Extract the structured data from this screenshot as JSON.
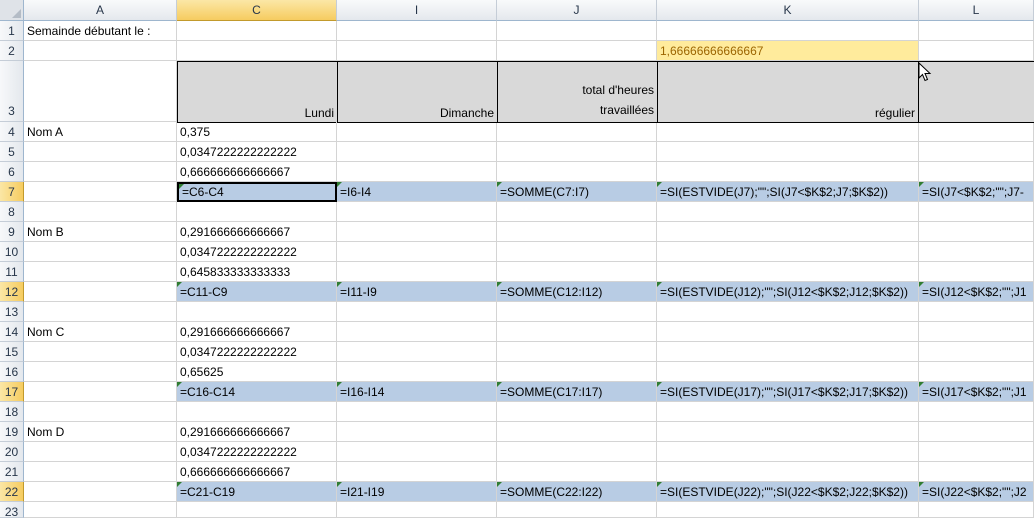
{
  "columns": [
    "A",
    "C",
    "I",
    "J",
    "K",
    "L"
  ],
  "rows": [
    "1",
    "2",
    "3",
    "4",
    "5",
    "6",
    "7",
    "8",
    "9",
    "10",
    "11",
    "12",
    "13",
    "14",
    "15",
    "16",
    "17",
    "18",
    "19",
    "20",
    "21",
    "22",
    "23"
  ],
  "cells": {
    "a1": "Semainde débutant le :",
    "k2": "1,66666666666667",
    "c3": "Lundi",
    "i3": "Dimanche",
    "j3_line1": "total d'heures",
    "j3_line2": "travaillées",
    "k3": "régulier",
    "a4": "Nom A",
    "c4": "0,375",
    "c5": "0,0347222222222222",
    "c6": "0,666666666666667",
    "c7": "=C6-C4",
    "i7": "=I6-I4",
    "j7": "=SOMME(C7:I7)",
    "k7": "=SI(ESTVIDE(J7);\"\";SI(J7<$K$2;J7;$K$2))",
    "l7": "=SI(J7<$K$2;\"\";J7-",
    "a9": "Nom B",
    "c9": "0,291666666666667",
    "c10": "0,0347222222222222",
    "c11": "0,645833333333333",
    "c12": "=C11-C9",
    "i12": "=I11-I9",
    "j12": "=SOMME(C12:I12)",
    "k12": "=SI(ESTVIDE(J12);\"\";SI(J12<$K$2;J12;$K$2))",
    "l12": "=SI(J12<$K$2;\"\";J1",
    "a14": "Nom C",
    "c14": "0,291666666666667",
    "c15": "0,0347222222222222",
    "c16": "0,65625",
    "c17": "=C16-C14",
    "i17": "=I16-I14",
    "j17": "=SOMME(C17:I17)",
    "k17": "=SI(ESTVIDE(J17);\"\";SI(J17<$K$2;J17;$K$2))",
    "l17": "=SI(J17<$K$2;\"\";J1",
    "a19": "Nom D",
    "c19": "0,291666666666667",
    "c20": "0,0347222222222222",
    "c21": "0,666666666666667",
    "c22": "=C21-C19",
    "i22": "=I21-I19",
    "j22": "=SOMME(C22:I22)",
    "k22": "=SI(ESTVIDE(J22);\"\";SI(J22<$K$2;J22;$K$2))",
    "l22": "=SI(J22<$K$2;\"\";J2"
  },
  "colors": {
    "selection_blue": "#b8cce4",
    "header_grey": "#d9d9d9",
    "highlight_yellow": "#ffeb9c",
    "header_selected": "#f6cc60"
  }
}
